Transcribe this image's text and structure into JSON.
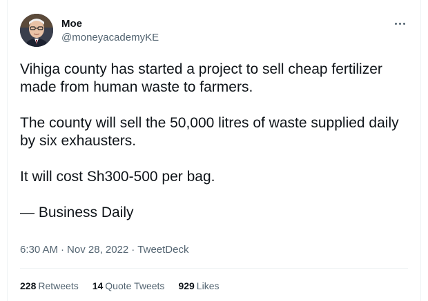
{
  "author": {
    "name": "Moe",
    "handle": "@moneyacademyKE",
    "avatar_icon": "profile-photo-avatar"
  },
  "more_icon": "more-options-icon",
  "tweet": {
    "paragraphs": [
      "Vihiga county has started a project to sell cheap fertilizer made from human waste to farmers.",
      "The county will sell the 50,000 litres of waste supplied daily by six exhausters.",
      "It will cost Sh300-500 per bag.",
      "— Business Daily"
    ]
  },
  "meta": {
    "time": "6:30 AM",
    "separator": "·",
    "date": "Nov 28, 2022",
    "source": "TweetDeck"
  },
  "stats": {
    "retweets": {
      "count": "228",
      "label": "Retweets"
    },
    "quote_tweets": {
      "count": "14",
      "label": "Quote Tweets"
    },
    "likes": {
      "count": "929",
      "label": "Likes"
    }
  },
  "colors": {
    "text_primary": "#0f1419",
    "text_secondary": "#536471",
    "divider": "#eff3f4"
  }
}
